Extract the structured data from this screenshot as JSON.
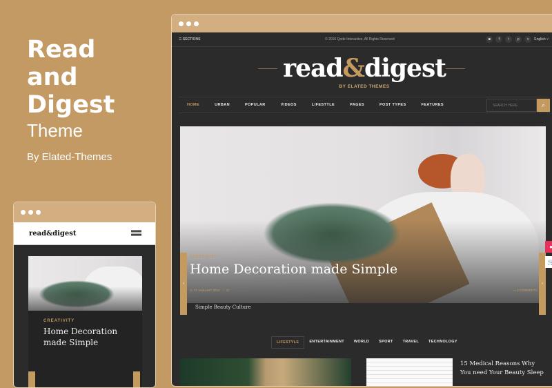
{
  "promo": {
    "title_lines": [
      "Read",
      "and",
      "Digest"
    ],
    "subtitle": "Theme",
    "byline": "By Elated-Themes"
  },
  "site": {
    "sections_label": "SECTIONS",
    "copyright": "© 2016 Qode Interactive, All Rights Reserved",
    "social_icons": [
      "instagram-icon",
      "facebook-icon",
      "twitter-icon",
      "pinterest-icon",
      "vimeo-icon"
    ],
    "language": "English",
    "logo": {
      "read": "read",
      "amp": "&",
      "digest": "digest",
      "tagline": "BY ELATED THEMES"
    },
    "nav": [
      "HOME",
      "URBAN",
      "POPULAR",
      "VIDEOS",
      "LIFESTYLE",
      "PAGES",
      "POST TYPES",
      "FEATURES"
    ],
    "search_placeholder": "SEARCH HERE",
    "hero": {
      "category": "CREATIVITY",
      "title": "Home Decoration made Simple",
      "date": "13 JANUARY 2016",
      "likes": "11",
      "comments": "3 COMMENTS",
      "thumbs_text": "Simple Beauty Culture"
    },
    "tabs": [
      "LIFESTYLE",
      "ENTERTAINMENT",
      "WORLD",
      "SPORT",
      "TRAVEL",
      "TECHNOLOGY"
    ],
    "post_title": "15 Medical Reasons Why You need Your Beauty Sleep"
  },
  "mobile": {
    "logo": "read&digest",
    "category": "CREATIVITY",
    "title": "Home Decoration made Simple"
  },
  "colors": {
    "background": "#c39a63",
    "accent": "#c59a5f",
    "dark": "#2b2b2b"
  }
}
